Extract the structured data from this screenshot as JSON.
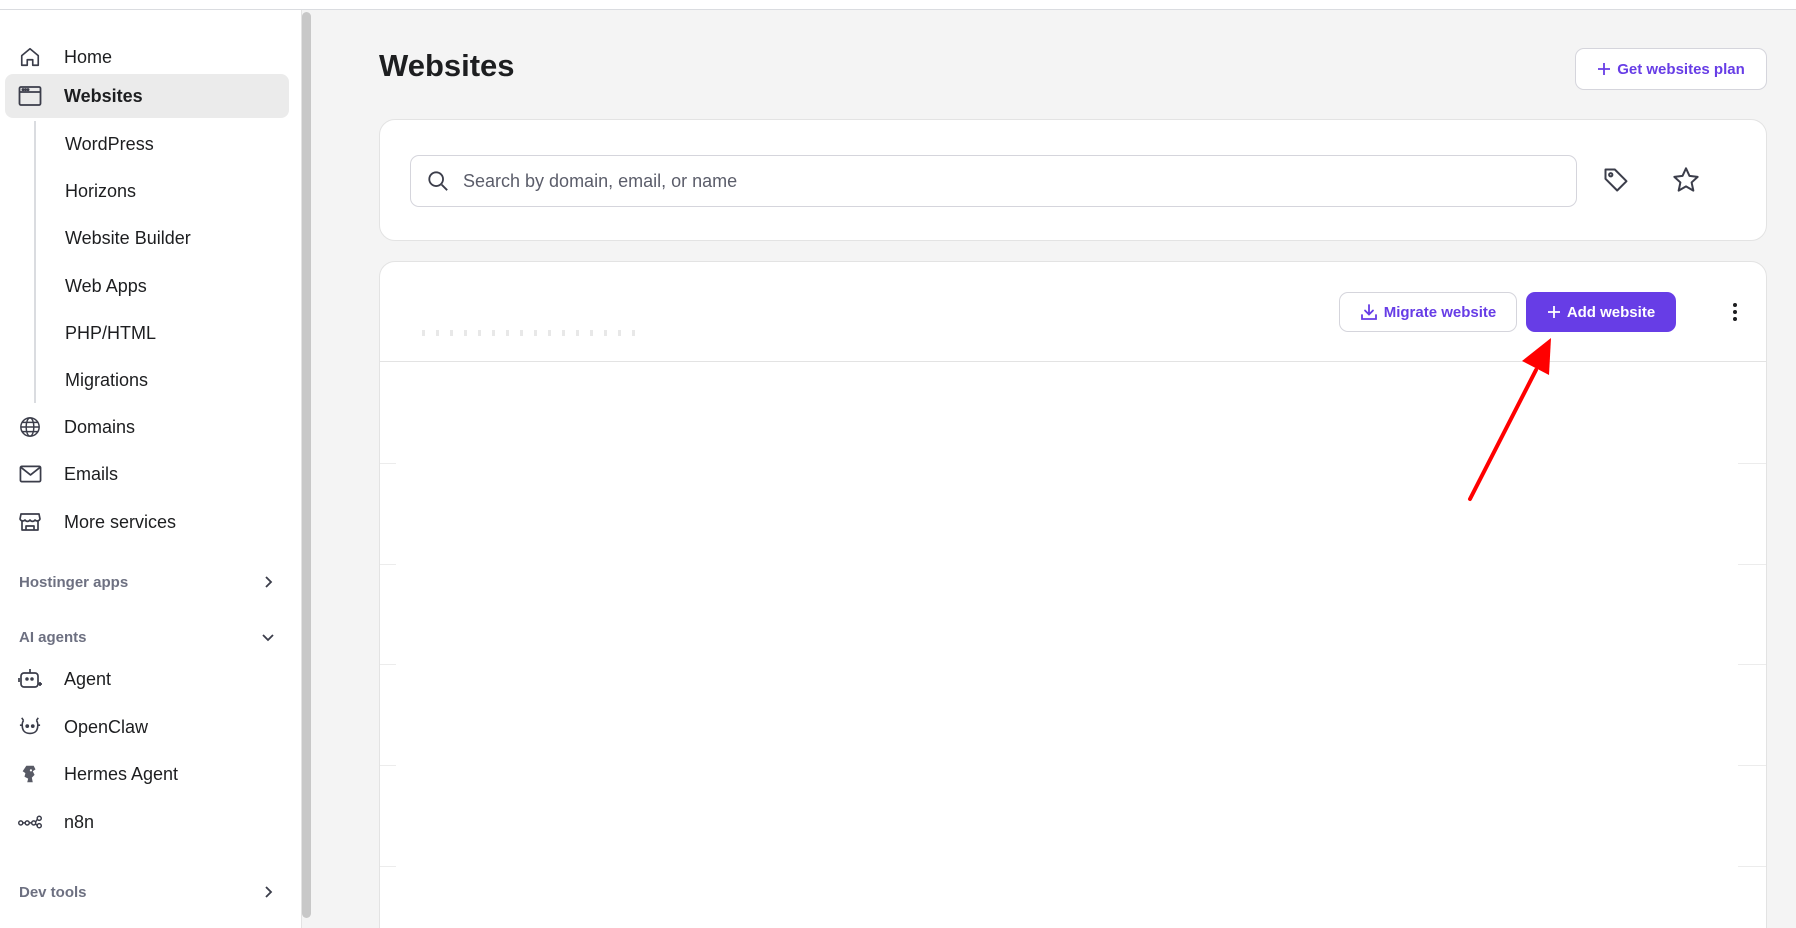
{
  "sidebar": {
    "home": "Home",
    "websites": "Websites",
    "sub_items": [
      "WordPress",
      "Horizons",
      "Website Builder",
      "Web Apps",
      "PHP/HTML",
      "Migrations"
    ],
    "domains": "Domains",
    "emails": "Emails",
    "more_services": "More services",
    "hostinger_apps": "Hostinger apps",
    "ai_agents": "AI agents",
    "agents": [
      "Agent",
      "OpenClaw",
      "Hermes Agent",
      "n8n"
    ],
    "dev_tools": "Dev tools"
  },
  "main": {
    "title": "Websites",
    "get_plan_label": "Get websites plan",
    "search": {
      "placeholder": "Search by domain, email, or name"
    },
    "migrate_label": "Migrate website",
    "add_label": "Add website"
  },
  "colors": {
    "accent": "#673de6",
    "annotation_arrow": "#ff0000"
  }
}
